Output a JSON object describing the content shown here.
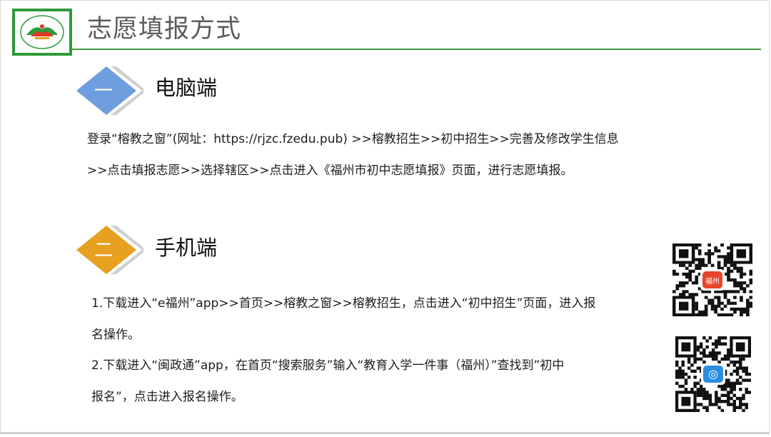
{
  "slide": {
    "title": "志愿填报方式",
    "logo": {
      "icon": "school-logo-icon",
      "color": "#2e9a3a"
    },
    "accent_line_color": "#3aa043"
  },
  "sections": [
    {
      "number": "一",
      "heading": "电脑端",
      "badge_color": "#6f9ee0",
      "lines": [
        "登录“榕教之窗”(网址：https://rjzc.fzedu.pub) >>榕教招生>>初中招生>>完善及修改学生信息",
        ">>点击填报志愿>>选择辖区>>点击进入《福州市初中志愿填报》页面，进行志愿填报。"
      ]
    },
    {
      "number": "二",
      "heading": "手机端",
      "badge_color": "#e8a020",
      "lines": [
        "1.下载进入“e福州”app>>首页>>榕教之窗>>榕教招生，点击进入“初中招生”页面，进入报",
        "名操作。",
        "2.下载进入“闽政通”app，在首页“搜索服务”输入“教育入学一件事（福州）”查找到”初中",
        "报名”，点击进入报名操作。"
      ]
    }
  ],
  "qr_codes": [
    {
      "icon": "qr-code-e-fuzhou-icon",
      "center_color": "#e8452c",
      "center_glyph": "福州"
    },
    {
      "icon": "qr-code-minzhengtong-icon",
      "center_color": "#2a8ee0",
      "center_glyph": "◎"
    }
  ]
}
